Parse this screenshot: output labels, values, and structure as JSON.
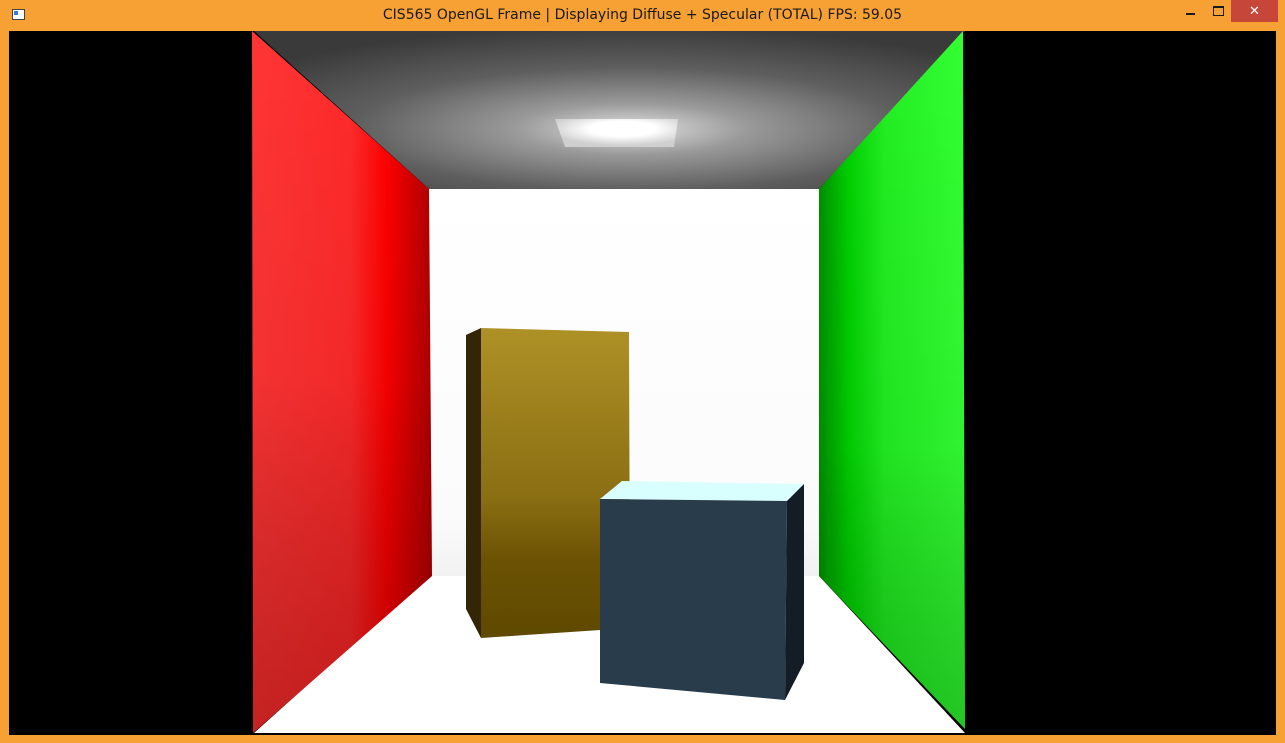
{
  "window": {
    "title": "CIS565 OpenGL Frame | Displaying Diffuse + Specular (TOTAL) FPS: 59.05",
    "controls": {
      "minimize_icon": "minimize-icon",
      "maximize_icon": "maximize-icon",
      "close_glyph": "✕"
    }
  },
  "scene": {
    "name": "cornell-box",
    "colors": {
      "left_wall": "#ff3030",
      "right_wall": "#22ee22",
      "back_wall": "#ffffff",
      "floor": "#ffffff",
      "ceiling": "#555555",
      "light": "#ffffff",
      "tall_box": "#a88a20",
      "short_box": "#283c4c",
      "short_box_top": "#d8ffff",
      "frame": "#f7a033",
      "background": "#000000"
    }
  }
}
